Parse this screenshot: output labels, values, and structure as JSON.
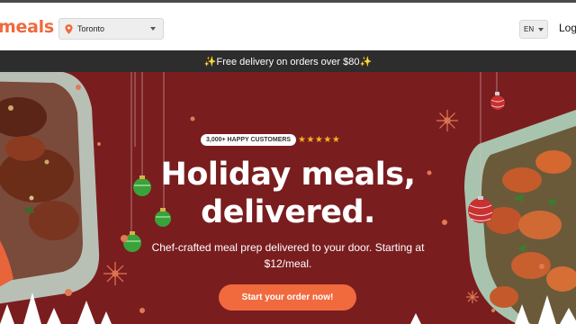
{
  "header": {
    "logo": "meals",
    "city": "Toronto",
    "language": "EN",
    "login": "Log"
  },
  "promo": {
    "text": "✨Free delivery on orders over $80✨"
  },
  "hero": {
    "badge": "3,000+ HAPPY CUSTOMERS",
    "stars": "★★★★★",
    "rating": 5,
    "headline_line1": "Holiday meals,",
    "headline_line2": "delivered.",
    "subtitle_line1": "Chef-crafted meal prep delivered to your door. Starting at",
    "subtitle_line2": "$12/meal.",
    "cta": "Start your order now!"
  },
  "colors": {
    "brand": "#f06a3e",
    "hero_background": "#7a1d1f",
    "promo_bar": "#2d2d2d",
    "star": "#f5b324"
  },
  "icons": {
    "city_icon": "location-pin-icon",
    "city_dropdown": "chevron-down-icon",
    "language_dropdown": "chevron-down-icon"
  }
}
